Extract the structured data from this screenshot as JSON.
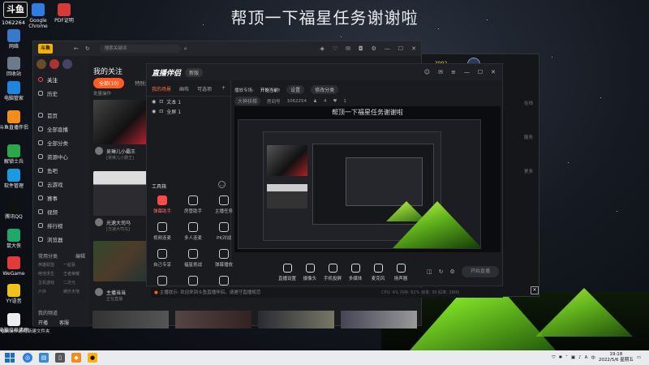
{
  "overlay_banner": "帮顶一下福星任务谢谢啦",
  "desktop": {
    "counter": "1062264",
    "icons": [
      {
        "label": "Google\nChrome",
        "icon": "chrome-icon",
        "color": "#2f7de1"
      },
      {
        "label": "PDF证明",
        "icon": "pdf-icon",
        "color": "#d43a3a"
      },
      {
        "label": "网络",
        "icon": "network-icon",
        "color": "#3a79c9"
      },
      {
        "label": "回收站",
        "icon": "recycle-bin-icon",
        "color": "#6b7b8c"
      },
      {
        "label": "电脑管家",
        "icon": "pc-manager-icon",
        "color": "#1f86e0"
      },
      {
        "label": "斗鱼直播伴侣",
        "icon": "douyu-companion-icon",
        "color": "#f28c1b"
      },
      {
        "label": "解锁士兵",
        "icon": "unlock-icon",
        "color": "#2aa84a"
      },
      {
        "label": "软件管理",
        "icon": "software-manager-icon",
        "color": "#1b9ae0"
      },
      {
        "label": "腾讯QQ",
        "icon": "qq-icon",
        "color": "#111"
      },
      {
        "label": "鼠大侠",
        "icon": "mouse-hero-icon",
        "color": "#1fa86a"
      },
      {
        "label": "WeGame",
        "icon": "wegame-icon",
        "color": "#e23b3b"
      },
      {
        "label": "YY语音",
        "icon": "yy-icon",
        "color": "#f0c21a"
      },
      {
        "label": "电脑垃圾清理",
        "icon": "cleaner-icon",
        "color": "#eeeeee"
      }
    ],
    "bottom_texts": [
      "电脑操作说明",
      "新建文件夹"
    ]
  },
  "douyu_client": {
    "logo": "斗鱼",
    "search_placeholder": "搜索关键词",
    "sidebar": [
      "关注",
      "历史",
      "首页",
      "全部直播",
      "全部分类",
      "资源中心",
      "鱼吧",
      "云游戏",
      "赛事",
      "视频",
      "排行榜",
      "浏览器"
    ],
    "page_title": "我的关注",
    "tab_active": "全部(10)",
    "tab_other": "特别关注",
    "streamers": [
      {
        "name": "吴琳儿小霸王",
        "sub": "[吴琳儿小霸王]"
      },
      {
        "name": "光速大司马",
        "sub": "[光速大司马]"
      },
      {
        "name": "主播当当",
        "sub": "正在直播"
      }
    ],
    "categories_header": "常用分类",
    "categories_manage": "编辑",
    "categories": [
      "英雄联盟",
      "一起看",
      "绝地求生",
      "王者荣耀",
      "主机游戏",
      "二次元",
      "户外",
      "娱乐天地"
    ],
    "bottom_menu": "我的频道",
    "bottom_actions": [
      "开播",
      "客服"
    ],
    "batch_ops": "批量操作"
  },
  "obs": {
    "logo": "直播伴侣",
    "version_badge": "新版",
    "tabs": [
      "我的场景",
      "画布",
      "可选项"
    ],
    "scene_items": [
      "文本 1",
      "全屏 1"
    ],
    "tools_header": "工具箱",
    "tools": [
      {
        "label": "弹幕助手",
        "highlight": true
      },
      {
        "label": "房管助手",
        "highlight": false
      },
      {
        "label": "主播任务",
        "highlight": false
      },
      {
        "label": "视频连麦",
        "highlight": false
      },
      {
        "label": "多人连麦",
        "highlight": false
      },
      {
        "label": "PK对战",
        "highlight": false
      },
      {
        "label": "自己专享",
        "highlight": false
      },
      {
        "label": "福星挑战",
        "highlight": false
      },
      {
        "label": "弹幕播放",
        "highlight": false
      },
      {
        "label": "更多",
        "highlight": false
      },
      {
        "label": "背包工具",
        "highlight": false
      },
      {
        "label": "帮助中心",
        "highlight": false
      }
    ],
    "top_bar": {
      "title_label": "播放专场:",
      "title_value": "开始当前!",
      "setting": "设置",
      "change_category": "修改分类",
      "room_label": "房间号",
      "room_value": "1062254",
      "viewers": "4",
      "followers": "1",
      "category": "大神扶梯"
    },
    "preview_caption": "帮顶一下福星任务谢谢啦",
    "bottom_tools": [
      "直播设置",
      "摄像头",
      "手机投屏",
      "多媒体",
      "麦克风",
      "扬声器"
    ],
    "start_button": "开始直播",
    "status": "CPU: 4%   内存: 62%   帧率: 30   码率: 2800",
    "notice": "主播提示:  欢迎来到斗鱼直播伴侣，请遵守直播规范"
  },
  "right_window": {
    "user_level": "3992",
    "side_labels": [
      "在线",
      "服务",
      "更多"
    ]
  },
  "taskbar": {
    "search_icon": "search-icon",
    "time": "19:18",
    "date": "2022/5/6 星期五",
    "lang": "中",
    "tray_letter": "A"
  }
}
